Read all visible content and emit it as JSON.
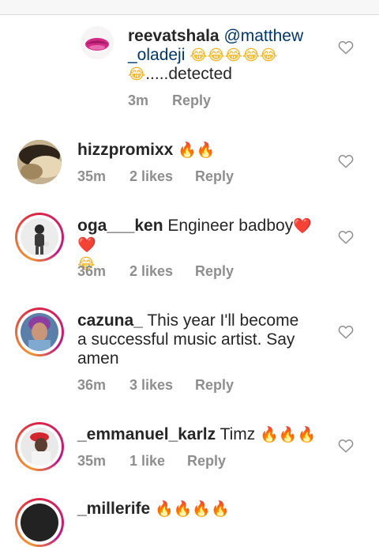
{
  "comments": [
    {
      "username": "reevatshala",
      "mention": "@matthew_oladeji",
      "mention_line1": "@matthew",
      "mention_line2": "_oladeji",
      "emojis_line2": "😂😂😂😂😂",
      "text_line3": ".....detected",
      "time": "3m",
      "likes": "",
      "reply": "Reply"
    },
    {
      "username": "hizzpromixx",
      "text": "🔥🔥",
      "time": "35m",
      "likes": "2 likes",
      "reply": "Reply"
    },
    {
      "username": "oga___ken",
      "text": "Engineer badboy",
      "emojis": "❤️❤️",
      "emoji_line2": "😂",
      "time": "36m",
      "likes": "2 likes",
      "reply": "Reply"
    },
    {
      "username": "cazuna_",
      "text_line1": "This year I'll become",
      "text_line2": "a successful music artist. Say",
      "text_line3": "amen",
      "time": "36m",
      "likes": "3 likes",
      "reply": "Reply"
    },
    {
      "username": "_emmanuel_karlz",
      "text": "Timz",
      "emojis": "🔥🔥🔥",
      "time": "35m",
      "likes": "1 like",
      "reply": "Reply"
    },
    {
      "username": "_millerife",
      "emojis": "🔥🔥🔥🔥"
    }
  ],
  "icons": {
    "like": "heart-outline-icon"
  },
  "colors": {
    "username": "#262626",
    "mention": "#00376b",
    "meta": "#8e8e8e",
    "story_ring": "#dc2743"
  }
}
